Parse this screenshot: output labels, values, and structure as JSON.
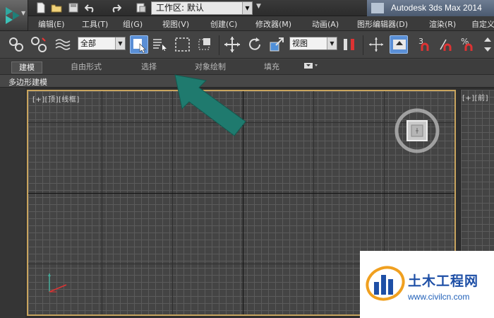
{
  "colors": {
    "accent_blue": "#5a8fd6",
    "viewport_border": "#c8a45e",
    "annotation_arrow": "#1f7a6e",
    "watermark_blue": "#1e4fa6"
  },
  "titlebar": {
    "workspace_label": "工作区: 默认",
    "app_name": "Autodesk 3ds Max  2014",
    "quick_access_icons": [
      "new-file-icon",
      "open-folder-icon",
      "save-icon",
      "undo-icon",
      "redo-icon",
      "project-folder-icon"
    ]
  },
  "menu": {
    "items": [
      {
        "label": "编辑(E)"
      },
      {
        "label": "工具(T)"
      },
      {
        "label": "组(G)"
      },
      {
        "label": "视图(V)"
      },
      {
        "label": "创建(C)"
      },
      {
        "label": "修改器(M)"
      },
      {
        "label": "动画(A)"
      },
      {
        "label": "图形编辑器(D)"
      },
      {
        "label": "渲染(R)"
      },
      {
        "label": "自定义"
      }
    ]
  },
  "toolbar": {
    "selection_filter": "全部",
    "reference_coord": "视图",
    "icons": [
      "link-icon",
      "unlink-icon",
      "bind-space-warp-icon",
      "select-object-icon",
      "select-by-name-icon",
      "rectangle-selection-icon",
      "window-crossing-icon",
      "move-icon",
      "rotate-icon",
      "scale-icon",
      "pivot-icon",
      "manipulate-icon",
      "keyboard-shortcut-icon",
      "snap-toggle-icon",
      "angle-snap-icon",
      "percent-snap-icon",
      "spinner-snap-icon"
    ]
  },
  "ribbon": {
    "tabs": [
      {
        "label": "建模",
        "active": true
      },
      {
        "label": "自由形式",
        "active": false
      },
      {
        "label": "选择",
        "active": false
      },
      {
        "label": "对象绘制",
        "active": false
      },
      {
        "label": "填充",
        "active": false
      }
    ],
    "panel_label": "多边形建模"
  },
  "viewports": {
    "top_label": "[+][顶][线框]",
    "front_label": "[+][前]"
  },
  "watermark": {
    "title": "土木工程网",
    "url": "www.civilcn.com"
  }
}
